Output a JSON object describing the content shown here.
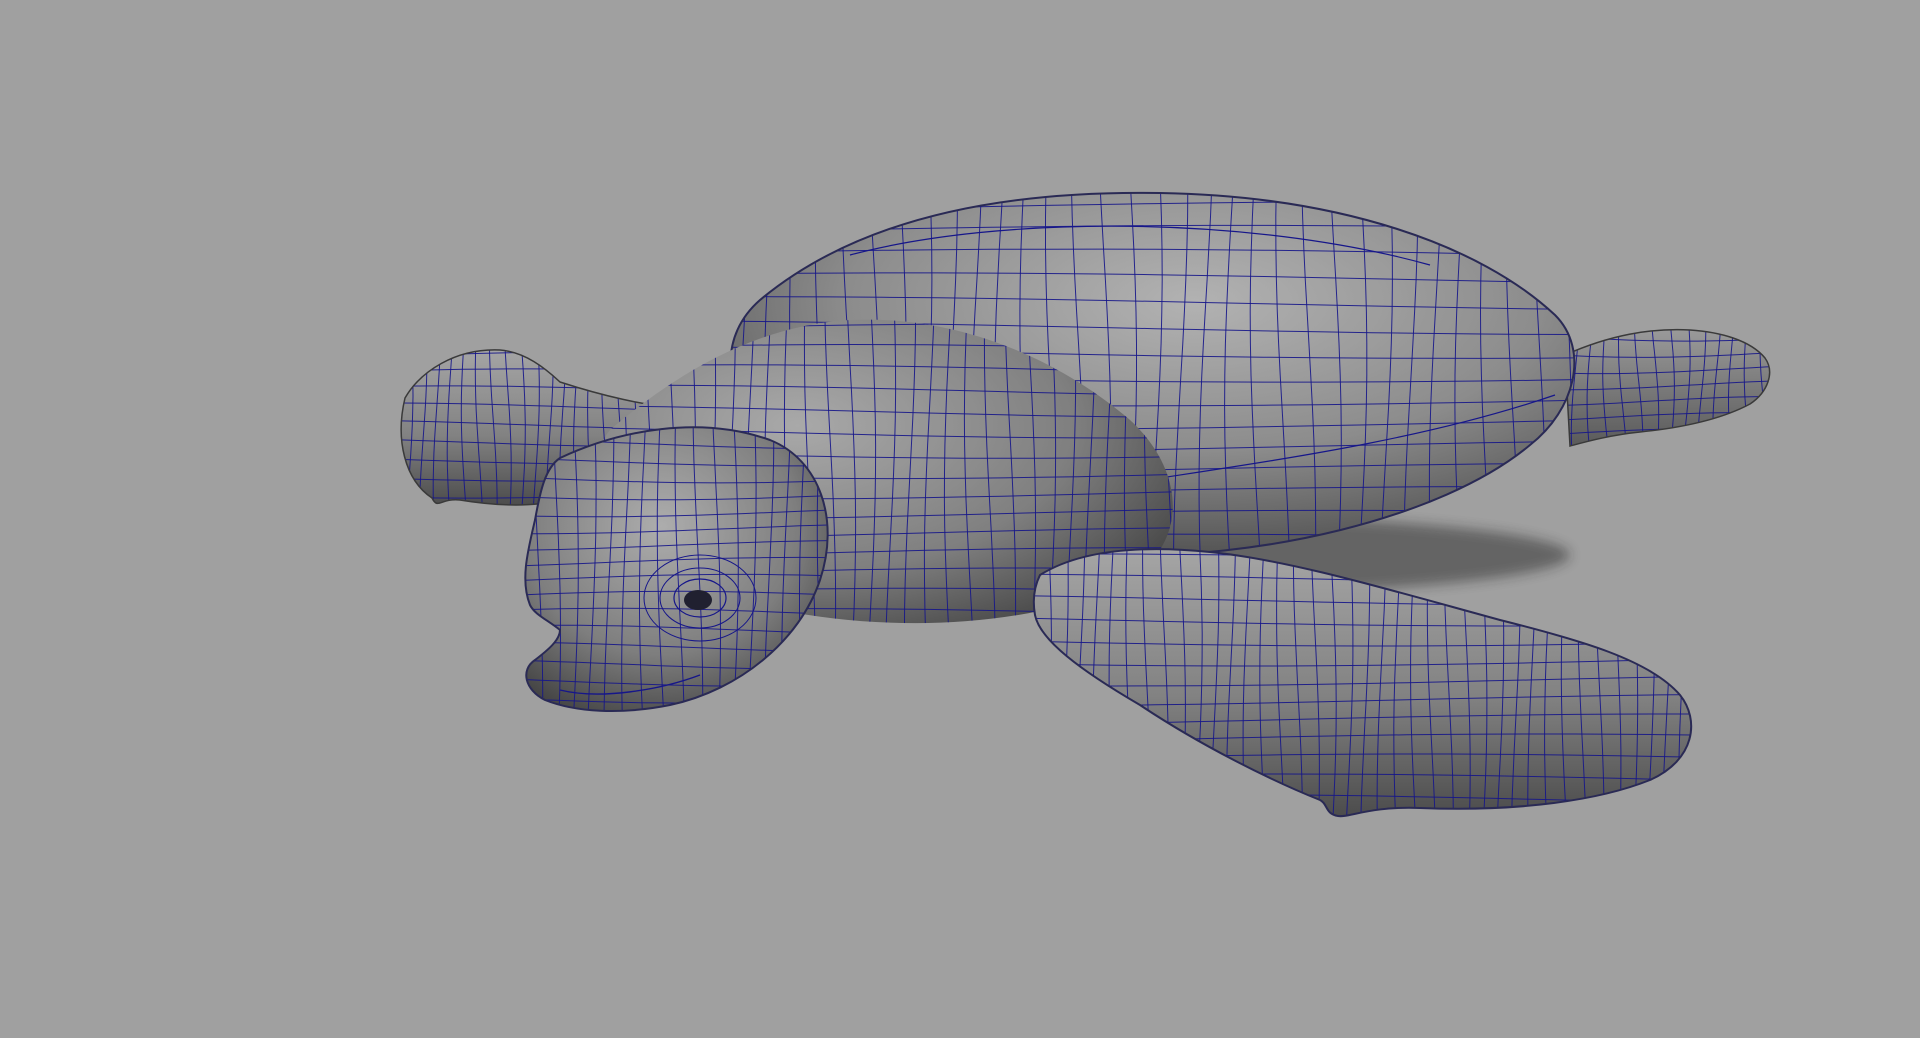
{
  "viewport": {
    "background_color": "#a0a0a0",
    "wire_color": "#16168a",
    "shade_light": "#aeaeae",
    "shade_mid": "#868686",
    "shade_dark": "#454545",
    "shadow_color": "#1a1a1a"
  },
  "model": {
    "name": "sea-turtle",
    "display_mode": "smooth-shaded-wireframe-on-shaded"
  }
}
